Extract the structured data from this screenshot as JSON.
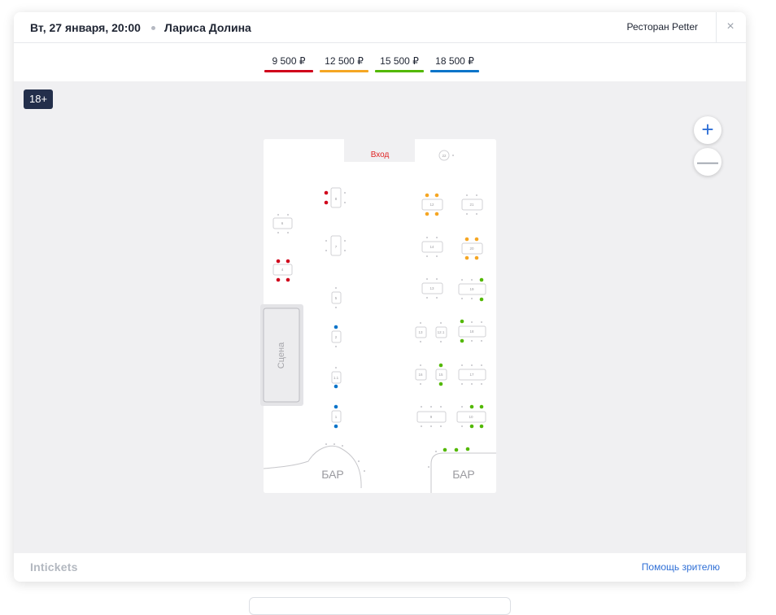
{
  "header": {
    "date": "Вт, 27 января, 20:00",
    "artist": "Лариса Долина",
    "venue": "Ресторан Petter",
    "close_icon": "×"
  },
  "prices": [
    {
      "label": "9 500 ₽",
      "color": "#d0021b"
    },
    {
      "label": "12 500 ₽",
      "color": "#f5a623"
    },
    {
      "label": "15 500 ₽",
      "color": "#52b800"
    },
    {
      "label": "18 500 ₽",
      "color": "#0a74c9"
    }
  ],
  "badge": {
    "age": "18+"
  },
  "zoom": {
    "in_label": "+",
    "out_label": "—"
  },
  "map": {
    "entrance": "Вход",
    "stage": "Сцена",
    "bar_left": "БАР",
    "bar_right": "БАР",
    "table_labels": {
      "t22": "22",
      "t8": "8",
      "t6": "6",
      "t7": "7",
      "t4": "4",
      "t5": "5",
      "t2": "2",
      "t11": "1.1",
      "t1": "1",
      "t12": "12",
      "t21": "21",
      "t14": "14",
      "t20": "20",
      "t13": "13",
      "t19": "19",
      "t131": "13",
      "t121": "12.1",
      "t18": "18",
      "t16": "16",
      "t15": "15",
      "t17": "17",
      "t9": "9",
      "t10": "10"
    }
  },
  "footer": {
    "logo": "Intickets",
    "help": "Помощь зрителю"
  }
}
